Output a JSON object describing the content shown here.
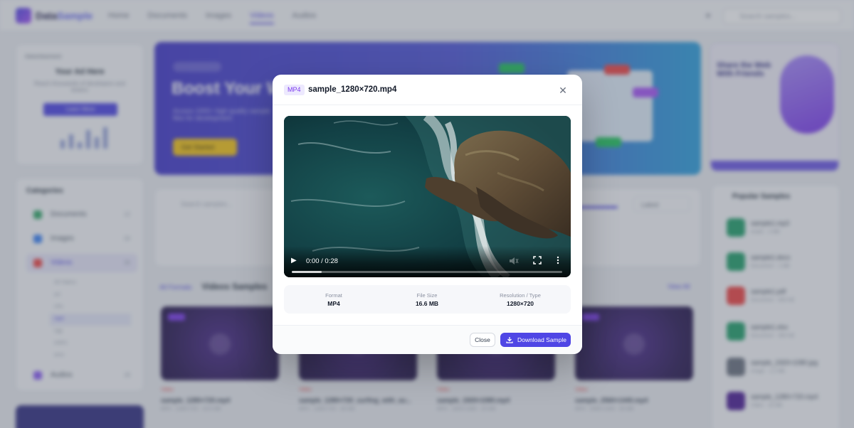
{
  "background": {
    "logo": {
      "brand_a": "Data",
      "brand_b": "Sample"
    },
    "nav": [
      "Home",
      "Documents",
      "Images",
      "Videos",
      "Audios"
    ],
    "search_placeholder": "Search samples...",
    "ad": {
      "label": "Advertisement",
      "title": "Your Ad Here",
      "subtitle": "Reach thousands of developers and testers",
      "button": "Learn More"
    },
    "categories": {
      "title": "Categories",
      "items": [
        {
          "label": "Documents",
          "count": "12",
          "color": "#34a86a"
        },
        {
          "label": "Images",
          "count": "24",
          "color": "#3b82f6"
        },
        {
          "label": "Videos",
          "count": "36",
          "color": "#ef4444"
        },
        {
          "label": "Audios",
          "count": "18",
          "color": "#8b5cf6"
        }
      ],
      "video_formats": [
        "All Videos",
        "avi",
        "mkv",
        "mp4",
        "ogg",
        "webm",
        "wmv"
      ]
    },
    "hero": {
      "title": "Boost Your W",
      "subtitle": "Access 1000+ high quality sample files for development",
      "cta": "Get Started"
    },
    "right_ad": {
      "title": "Share the Web With Friends"
    },
    "popular": {
      "title": "Popular Samples",
      "items": [
        {
          "name": "sample1.mp3",
          "meta": "Audio · 2 MB",
          "color": "#22a06b"
        },
        {
          "name": "sample1.docx",
          "meta": "Document · 1 MB",
          "color": "#22a06b"
        },
        {
          "name": "sample1.pdf",
          "meta": "Document · 400 KB",
          "color": "#ef4444"
        },
        {
          "name": "sample1.xlsx",
          "meta": "Document · 300 KB",
          "color": "#22a06b"
        },
        {
          "name": "sample_1920×1080.jpg",
          "meta": "Image · 1.2 MB",
          "color": "#6b7280"
        },
        {
          "name": "sample_1280×720.mp4",
          "meta": "Video · 16 MB",
          "color": "#4c1d95"
        }
      ]
    },
    "filters": {
      "search_placeholder": "Search samples...",
      "sort": "Latest"
    },
    "section": {
      "back": "All Formats",
      "title": "Videos Samples",
      "view_all": "View All"
    },
    "video_cards": [
      {
        "category": "Video",
        "name": "sample_1280×720.mp4",
        "meta": "MP4 · 1280×720 · 16.6 MB"
      },
      {
        "category": "Video",
        "name": "sample_1280×720_surfing_with_au...",
        "meta": "MP4 · 1280×720 · 36 MB"
      },
      {
        "category": "Video",
        "name": "sample_1920×1080.mp4",
        "meta": "MP4 · 1920×1080 · 20 MB"
      },
      {
        "category": "Video",
        "name": "sample_2560×1440.mp4",
        "meta": "MP4 · 2560×1440 · 30 MB"
      }
    ]
  },
  "modal": {
    "format_badge": "MP4",
    "title": "sample_1280×720.mp4",
    "close_icon": "close-icon",
    "player": {
      "time": "0:00 / 0:28",
      "buffered_fraction": 0.11,
      "icons": [
        "play-icon",
        "mute-icon",
        "fullscreen-icon",
        "more-options-icon"
      ]
    },
    "stats": [
      {
        "label": "Format",
        "value": "MP4"
      },
      {
        "label": "File Size",
        "value": "16.6 MB"
      },
      {
        "label": "Resolution / Type",
        "value": "1280×720"
      }
    ],
    "buttons": {
      "close": "Close",
      "download": "Download Sample"
    },
    "colors": {
      "accent": "#4f46e5",
      "badge_text": "#7c3aed",
      "badge_bg": "#ede9fe"
    }
  }
}
